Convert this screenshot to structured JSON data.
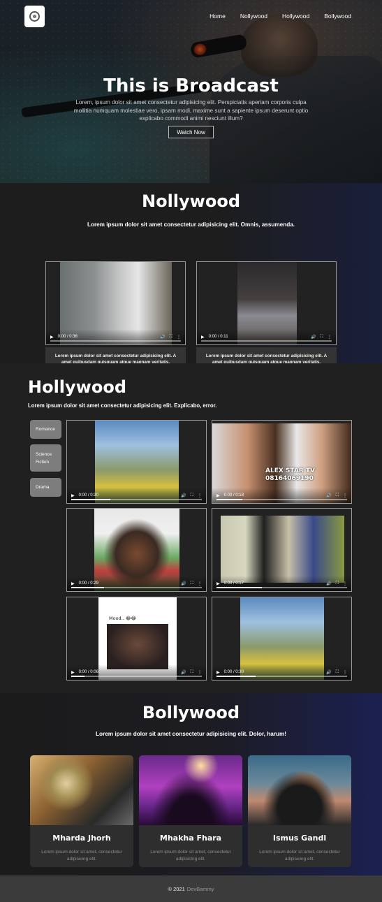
{
  "nav": {
    "items": [
      "Home",
      "Nollywood",
      "Hollywood",
      "Bollywood"
    ]
  },
  "hero": {
    "title": "This is Broadcast",
    "text": "Lorem, ipsum dolor sit amet consectetur adipisicing elit. Perspiciatis aperiam corporis culpa mollitia numquam molestiae vero, ipsam modi, maxime sunt a sapiente ipsum deserunt optio explicabo commodi animi nesciunt illum?",
    "button": "Watch Now"
  },
  "nollywood": {
    "title": "Nollywood",
    "subtitle": "Lorem ipsum dolor sit amet consectetur adipisicing elit. Omnis, assumenda.",
    "videos": [
      {
        "time": "0:00 / 0:36",
        "caption": "Lorem ipsum dolor sit amet consectetur adipisicing elit. A amet quibusdam quisquam atque magnam veritatis."
      },
      {
        "time": "0:00 / 0:11",
        "caption": "Lorem ipsum dolor sit amet consectetur adipisicing elit. A amet quibusdam quisquam atque magnam veritatis."
      }
    ]
  },
  "hollywood": {
    "title": "Hollywood",
    "subtitle": "Lorem ipsum dolor sit amet consectetur adipisicing elit. Explicabo, error.",
    "genres": [
      "Romance",
      "Science Fiction",
      "Drama"
    ],
    "videos": [
      {
        "time": "0:00 / 0:30"
      },
      {
        "time": "0:00 / 0:18",
        "overlay": "ALEX STAR TV\n08164069190"
      },
      {
        "time": "0:00 / 0:29"
      },
      {
        "time": "0:00 / 0:17"
      },
      {
        "time": "0:00 / 0:06",
        "overlay": "Mood.. 😂😂"
      },
      {
        "time": "0:00 / 0:30"
      }
    ]
  },
  "bollywood": {
    "title": "Bollywood",
    "subtitle": "Lorem ipsum dolor sit amet consectetur adipisicing elit. Dolor, harum!",
    "cards": [
      {
        "name": "Mharda Jhorh",
        "desc": "Lorem ipsum dolor sit amet, consectetur adipisicing elit."
      },
      {
        "name": "Mhakha Fhara",
        "desc": "Lorem ipsum dolor sit amet, consectetur adipisicing elit."
      },
      {
        "name": "Ismus Gandi",
        "desc": "Lorem ipsum dolor sit amet, consectetur adipisicing elit."
      }
    ]
  },
  "footer": {
    "text": "© 2021",
    "brand": "DevBammy"
  }
}
